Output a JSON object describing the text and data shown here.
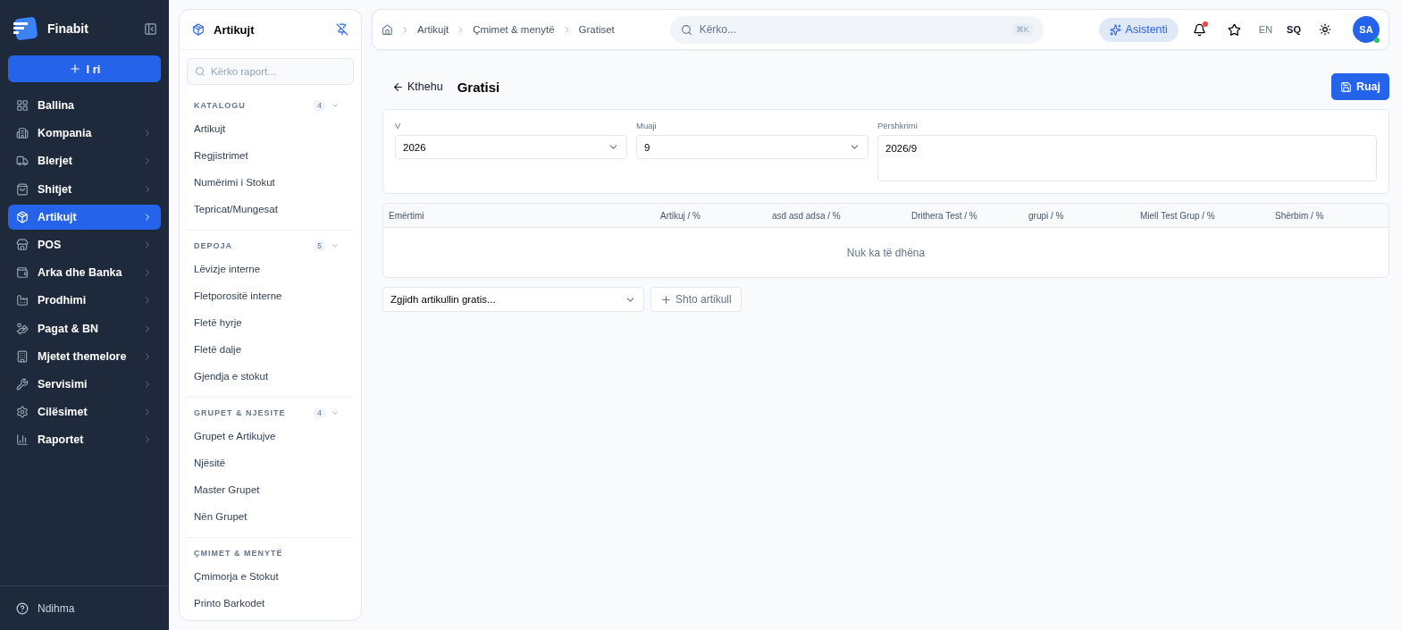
{
  "brand": {
    "name": "Finabit"
  },
  "new_button": {
    "label": "I ri"
  },
  "nav": [
    {
      "label": "Ballina",
      "has_arrow": false,
      "selected": false
    },
    {
      "label": "Kompania",
      "has_arrow": true,
      "selected": false
    },
    {
      "label": "Blerjet",
      "has_arrow": true,
      "selected": false
    },
    {
      "label": "Shitjet",
      "has_arrow": true,
      "selected": false
    },
    {
      "label": "Artikujt",
      "has_arrow": true,
      "selected": true
    },
    {
      "label": "POS",
      "has_arrow": true,
      "selected": false
    },
    {
      "label": "Arka dhe Banka",
      "has_arrow": true,
      "selected": false
    },
    {
      "label": "Prodhimi",
      "has_arrow": true,
      "selected": false
    },
    {
      "label": "Pagat & BN",
      "has_arrow": true,
      "selected": false
    },
    {
      "label": "Mjetet themelore",
      "has_arrow": true,
      "selected": false
    },
    {
      "label": "Servisimi",
      "has_arrow": true,
      "selected": false
    },
    {
      "label": "Cilësimet",
      "has_arrow": true,
      "selected": false
    },
    {
      "label": "Raportet",
      "has_arrow": true,
      "selected": false
    }
  ],
  "help": {
    "label": "Ndihma"
  },
  "subpanel": {
    "title": "Artikujt",
    "search_placeholder": "Kërko raport...",
    "sections": [
      {
        "title": "KATALOGU",
        "count": "4",
        "expanded": true,
        "items": [
          "Artikujt",
          "Regjistrimet",
          "Numërimi i Stokut",
          "Tepricat/Mungesat"
        ]
      },
      {
        "title": "DEPOJA",
        "count": "5",
        "expanded": true,
        "items": [
          "Lëvizje interne",
          "Fletporositë interne",
          "Fletë hyrje",
          "Fletë dalje",
          "Gjendja e stokut"
        ]
      },
      {
        "title": "GRUPET & NJESITE",
        "count": "4",
        "expanded": true,
        "items": [
          "Grupet e Artikujve",
          "Njësitë",
          "Master Grupet",
          "Nën Grupet"
        ]
      },
      {
        "title": "ÇMIMET & MENYTË",
        "items": [
          "Çmimorja e Stokut",
          "Printo Barkodet"
        ]
      }
    ]
  },
  "breadcrumb": [
    "Artikujt",
    "Çmimet & menytë",
    "Gratiset"
  ],
  "search": {
    "placeholder": "Kërko...",
    "shortcut": "⌘K"
  },
  "assistant_button": {
    "label": "Asistenti"
  },
  "notifications": {
    "unread": true
  },
  "languages": [
    {
      "code": "EN",
      "selected": false
    },
    {
      "code": "SQ",
      "selected": true
    }
  ],
  "avatar": {
    "initials": "SA",
    "online": true
  },
  "page": {
    "back_label": "Kthehu",
    "title": "Gratisi",
    "save_label": "Ruaj"
  },
  "form": {
    "year_label": "V",
    "year_value": "2026",
    "month_label": "Muaji",
    "month_value": "9",
    "description_label": "Përshkrimi",
    "description_value": "2026/9"
  },
  "table": {
    "columns": [
      "Emërtimi",
      "Artikuj / %",
      "asd asd adsa / %",
      "Drithera Test / %",
      "grupi / %",
      "Miell Test Grup / %",
      "Shërbim / %"
    ],
    "empty_text": "Nuk ka të dhëna"
  },
  "add_row": {
    "select_placeholder": "Zgjidh artikullin gratis...",
    "add_label": "Shto artikull"
  }
}
